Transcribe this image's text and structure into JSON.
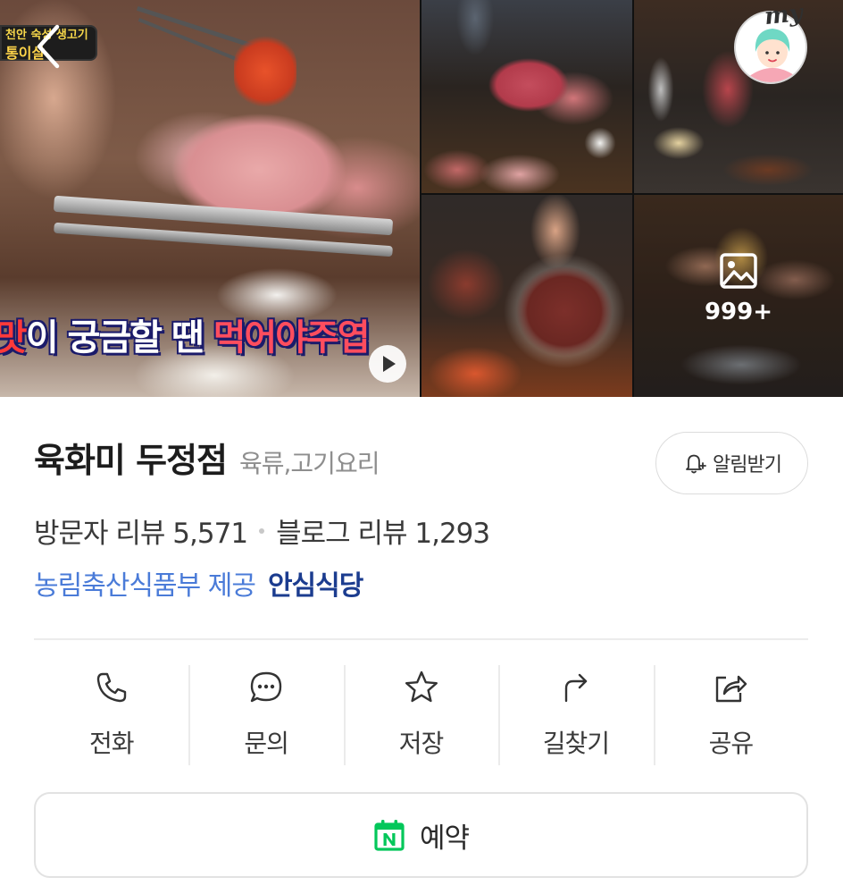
{
  "gallery": {
    "video_tag": {
      "line1": "천안 숙성 생고기",
      "line2": "통이살"
    },
    "video_caption": {
      "part1": "맛",
      "part2": "이 궁금할 땐 ",
      "part3": "먹어야주엽"
    },
    "more_count": "999+",
    "avatar_text": "my"
  },
  "place": {
    "name": "육화미 두정점",
    "category": "육류,고기요리",
    "alert_label": "알림받기"
  },
  "reviews": {
    "visitor": "방문자 리뷰 5,571",
    "blog": "블로그 리뷰 1,293"
  },
  "certification": {
    "provider": "농림축산식품부 제공",
    "badge": "안심식당"
  },
  "actions": [
    {
      "label": "전화",
      "icon": "phone-icon"
    },
    {
      "label": "문의",
      "icon": "chat-bubble-icon"
    },
    {
      "label": "저장",
      "icon": "star-icon"
    },
    {
      "label": "길찾기",
      "icon": "directions-arrow-icon"
    },
    {
      "label": "공유",
      "icon": "share-icon"
    }
  ],
  "reservation": {
    "label": "예약",
    "icon": "naver-calendar-icon",
    "accent": "#03c75a"
  },
  "colors": {
    "link_blue": "#4a7bd8",
    "badge_navy": "#1b3c8f",
    "muted_gray": "#8e8e8e"
  }
}
